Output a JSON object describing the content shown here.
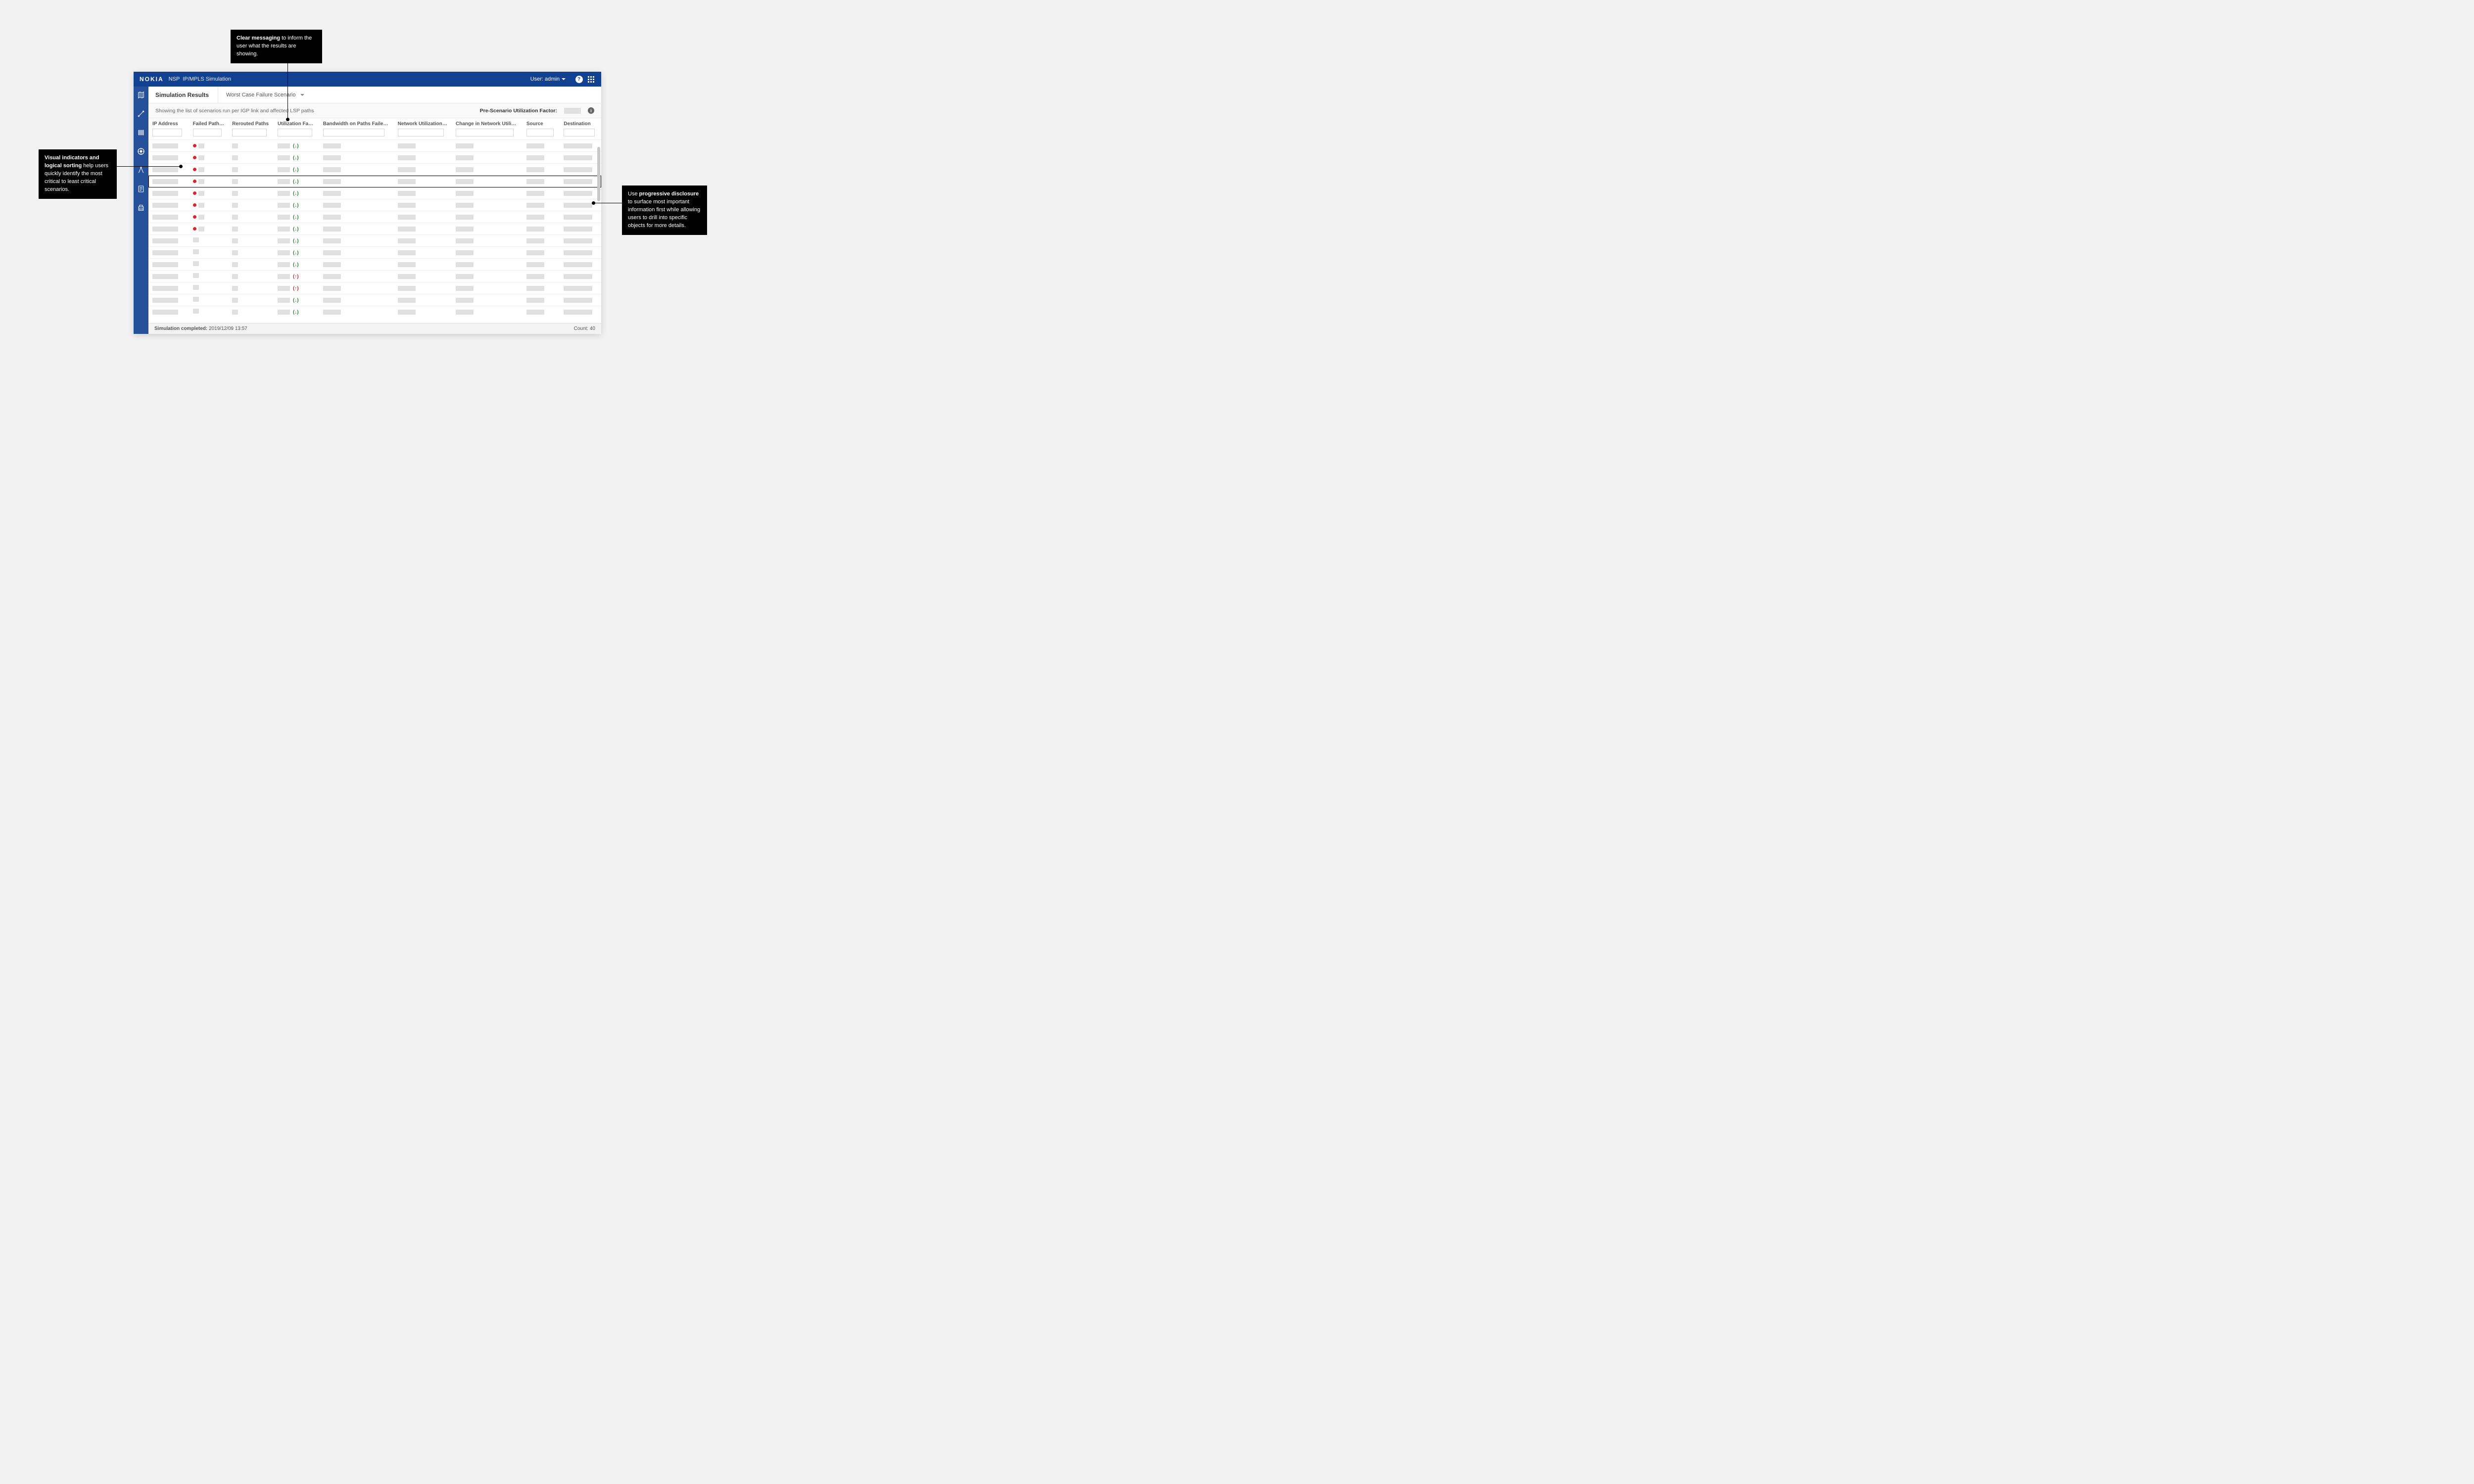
{
  "header": {
    "logo": "NOKIA",
    "product": "NSP",
    "module": "IP/MPLS Simulation",
    "user_label": "User: admin",
    "help_glyph": "?",
    "info_glyph": "i"
  },
  "subheader": {
    "title": "Simulation Results",
    "scenario_selected": "Worst Case Failure Scenario"
  },
  "descrow": {
    "text": "Showing the list of scenarios run per IGP link and affected LSP paths",
    "pre_util_label": "Pre-Scenario Utilization Factor:"
  },
  "columns": {
    "ip": "IP Address",
    "failed": "Failed Paths",
    "rerouted": "Rerouted Paths",
    "util": "Utilization Factor",
    "bw": "Bandwidth on Paths Failed (Mbps)",
    "netutil": "Network Utilization (%)",
    "change": "Change in Network Utilization…",
    "source": "Source",
    "dest": "Destination",
    "sort_arrow": "↑"
  },
  "rows": [
    {
      "status": "red",
      "util_dir": "down"
    },
    {
      "status": "red",
      "util_dir": "down"
    },
    {
      "status": "red",
      "util_dir": "down"
    },
    {
      "status": "red",
      "util_dir": "down",
      "highlight": true
    },
    {
      "status": "red",
      "util_dir": "down"
    },
    {
      "status": "red",
      "util_dir": "down"
    },
    {
      "status": "red",
      "util_dir": "down"
    },
    {
      "status": "red",
      "util_dir": "down"
    },
    {
      "status": "none",
      "util_dir": "down"
    },
    {
      "status": "none",
      "util_dir": "down"
    },
    {
      "status": "none",
      "util_dir": "down"
    },
    {
      "status": "none",
      "util_dir": "up"
    },
    {
      "status": "none",
      "util_dir": "up"
    },
    {
      "status": "none",
      "util_dir": "down"
    },
    {
      "status": "none",
      "util_dir": "down"
    }
  ],
  "util_glyphs": {
    "down": "(↓)",
    "up": "(↑)"
  },
  "footer": {
    "completed_label": "Simulation completed:",
    "completed_value": "2019/12/09 13:57",
    "count_label": "Count:",
    "count_value": "40"
  },
  "annotations": {
    "top": {
      "bold": "Clear messaging",
      "rest": " to inform the user what the results are showing."
    },
    "left": {
      "bold": "Visual indicators and logical sorting",
      "rest": " help users quickly identify the most critical to least critical scenarios."
    },
    "right": {
      "prefix": "Use ",
      "bold": "progressive disclosure",
      "rest": " to surface most important information first while allowing users to drill into specific objects for more details."
    }
  }
}
